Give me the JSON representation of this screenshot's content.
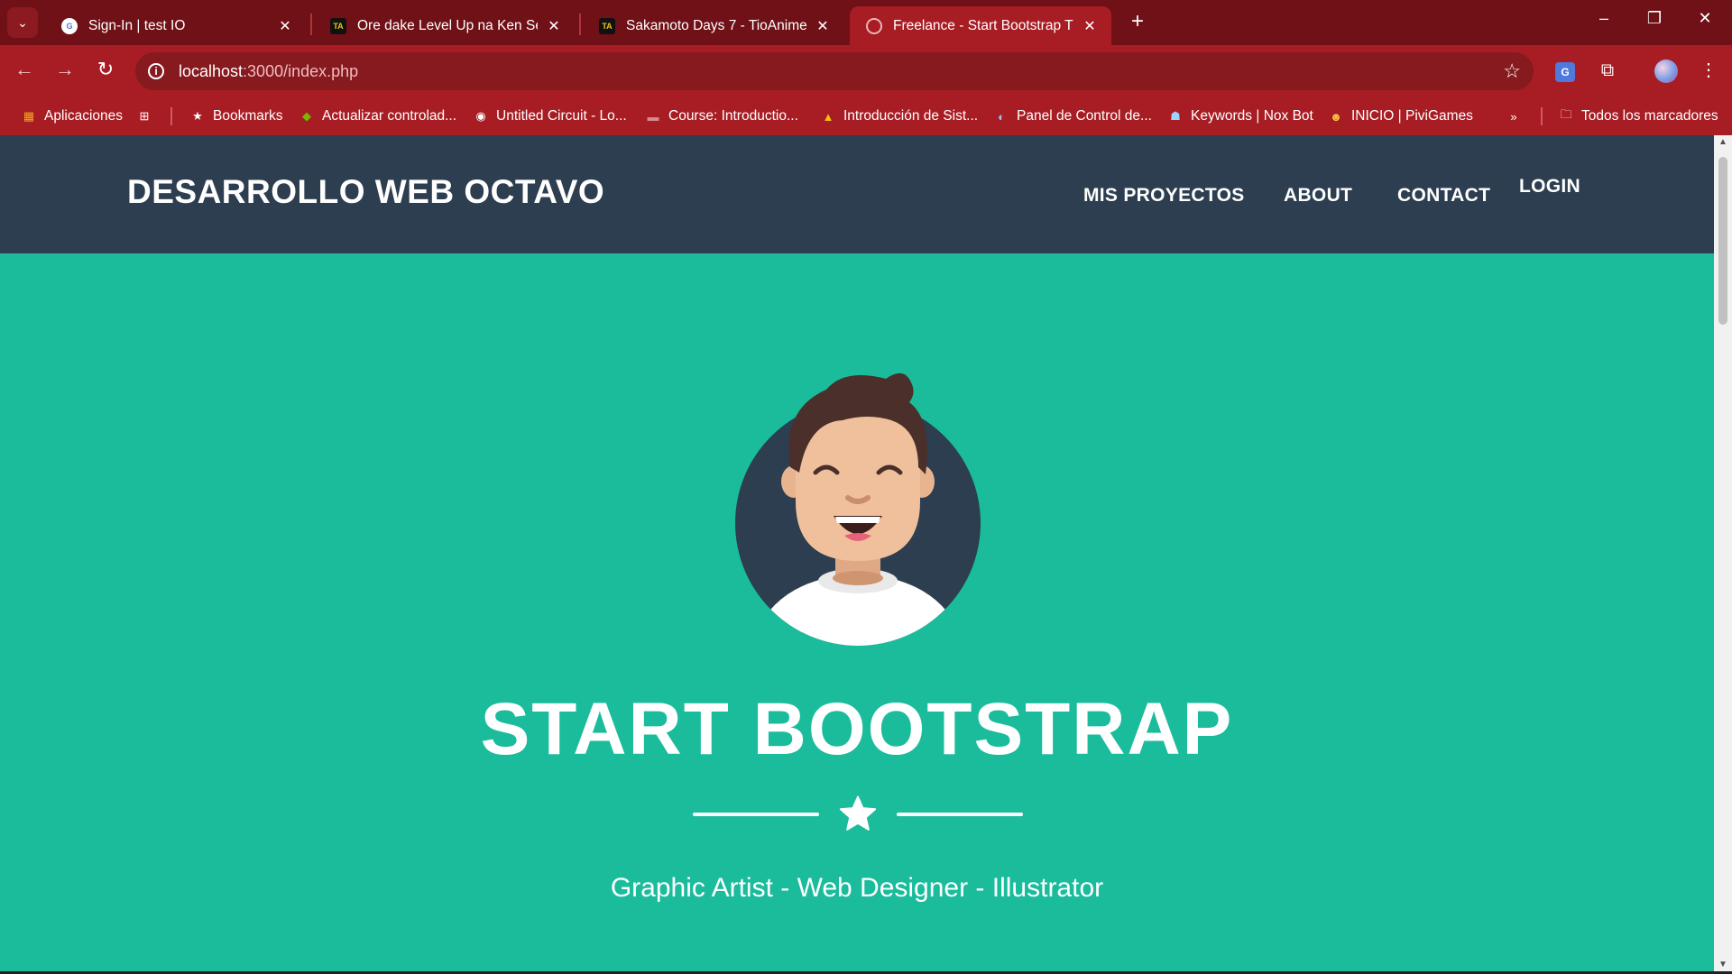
{
  "browser": {
    "tabs": [
      {
        "title": "Sign-In | test IO",
        "icon": "google-account-icon"
      },
      {
        "title": "Ore dake Level Up na Ken Season",
        "icon": "tioanime-icon"
      },
      {
        "title": "Sakamoto Days 7 - TioAnime",
        "icon": "tioanime-icon"
      },
      {
        "title": "Freelance - Start Bootstrap Theme",
        "icon": "globe-icon",
        "active": true
      }
    ],
    "tab_favicon_text": "TA",
    "address": {
      "host": "localhost",
      "path": ":3000/index.php"
    },
    "bookmarks": [
      "Aplicaciones",
      "Bookmarks",
      "Actualizar controlad...",
      "Untitled Circuit - Lo...",
      "Course: Introductio...",
      "Introducción de Sist...",
      "Panel de Control de...",
      "Keywords | Nox Bot",
      "INICIO | PiviGames"
    ],
    "all_bookmarks": "Todos los marcadores",
    "colors": {
      "tabstrip": "#6f1116",
      "toolbar": "#a81d24"
    }
  },
  "page": {
    "brand": "DESARROLLO WEB OCTAVO",
    "nav": [
      "MIS PROYECTOS",
      "ABOUT",
      "CONTACT",
      "LOGIN"
    ],
    "hero_title": "START BOOTSTRAP",
    "hero_subtitle": "Graphic Artist - Web Designer - Illustrator",
    "colors": {
      "navbar": "#2c3e50",
      "hero": "#1abc9c"
    }
  }
}
